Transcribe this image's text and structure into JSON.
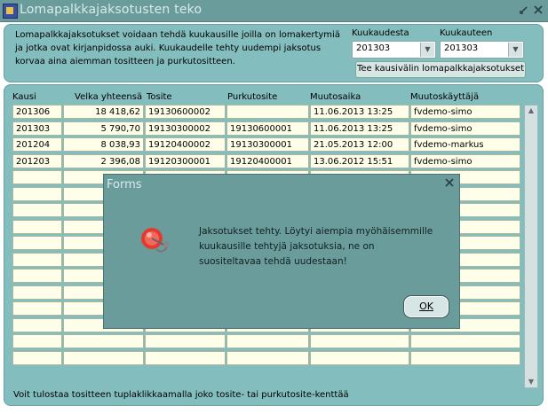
{
  "window": {
    "title": "Lomapalkkajaksotusten teko",
    "controls": [
      "minimize-restore",
      "close"
    ]
  },
  "header": {
    "info_lines": [
      "Lomapalkkajaksotukset voidaan tehdä kuukausille joilla on lomakertymiä",
      "ja jotka ovat kirjanpidossa auki. Kuukaudelle tehty uudempi jaksotus",
      "korvaa aina aiemman tositteen ja purkutositteen."
    ],
    "from_label": "Kuukaudesta",
    "from_value": "201303",
    "to_label": "Kuukauteen",
    "to_value": "201303",
    "run_button": "Tee kausivälin lomapalkkajaksotukset"
  },
  "table": {
    "columns": [
      "Kausi",
      "Velka yhteensä",
      "Tosite",
      "Purkutosite",
      "Muutosaika",
      "Muutoskäyttäjä"
    ],
    "rows": [
      [
        "201306",
        "18 418,62",
        "19130600002",
        "",
        "11.06.2013 13:25",
        "fvdemo-simo"
      ],
      [
        "201303",
        "5 790,70",
        "19130300002",
        "19130600001",
        "11.06.2013 13:25",
        "fvdemo-simo"
      ],
      [
        "201204",
        "8 038,93",
        "19120400002",
        "19130300001",
        "21.05.2013 12:00",
        "fvdemo-markus"
      ],
      [
        "201203",
        "2 396,08",
        "19120300001",
        "19120400001",
        "13.06.2012 15:51",
        "fvdemo-simo"
      ]
    ],
    "empty_rows": 12
  },
  "footer": "Voit tulostaa tositteen tuplaklikkaamalla joko tosite- tai purkutosite-kenttää",
  "dialog": {
    "title": "Forms",
    "message": "Jaksotukset tehty. Löytyi aiempia myöhäisemmille kuukausille tehtyjä jaksotuksia, ne on suositeltavaa tehdä uudestaan!",
    "ok_label": "OK",
    "icon": "bell-icon"
  },
  "colors": {
    "titlebar": "#6b9c9c",
    "panel": "#84bdbd",
    "cell": "#fffee9"
  }
}
